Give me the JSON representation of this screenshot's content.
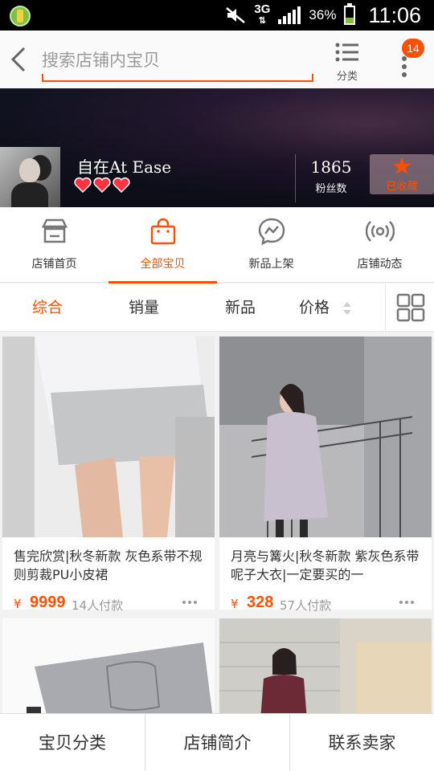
{
  "status_bar": {
    "battery_percent": "36%",
    "battery_level": 0.36,
    "network": "3G",
    "time": "11:06",
    "icons": [
      "app-notification-icon",
      "mute-icon",
      "network-3g-icon",
      "signal-icon",
      "battery-icon"
    ]
  },
  "header": {
    "search_placeholder": "搜索店铺内宝贝",
    "category_label": "分类",
    "badge_count": "14",
    "accent_color": "#ff5000"
  },
  "shop": {
    "name": "自在At Ease",
    "rating_hearts": 3,
    "fans_count": "1865",
    "fans_label": "粉丝数",
    "favorite_label": "已收藏"
  },
  "nav_tabs": [
    {
      "label": "店铺首页",
      "icon": "store-icon",
      "active": false
    },
    {
      "label": "全部宝贝",
      "icon": "shopping-bag-icon",
      "active": true
    },
    {
      "label": "新品上架",
      "icon": "new-arrivals-icon",
      "active": false
    },
    {
      "label": "店铺动态",
      "icon": "broadcast-icon",
      "active": false
    }
  ],
  "sort": {
    "overall": "综合",
    "sales": "销量",
    "new": "新品",
    "price": "价格",
    "active": "综合"
  },
  "products": [
    {
      "title": "售完欣赏|秋冬新款 灰色系带不规则剪裁PU小皮裙",
      "price_symbol": "¥",
      "price": "9999",
      "sold": "14人付款"
    },
    {
      "title": "月亮与篝火|秋冬新款 紫灰色系带呢子大衣|一定要买的一",
      "price_symbol": "¥",
      "price": "328",
      "sold": "57人付款"
    }
  ],
  "bottom_bar": {
    "categories": "宝贝分类",
    "shop_intro": "店铺简介",
    "contact_seller": "联系卖家"
  }
}
